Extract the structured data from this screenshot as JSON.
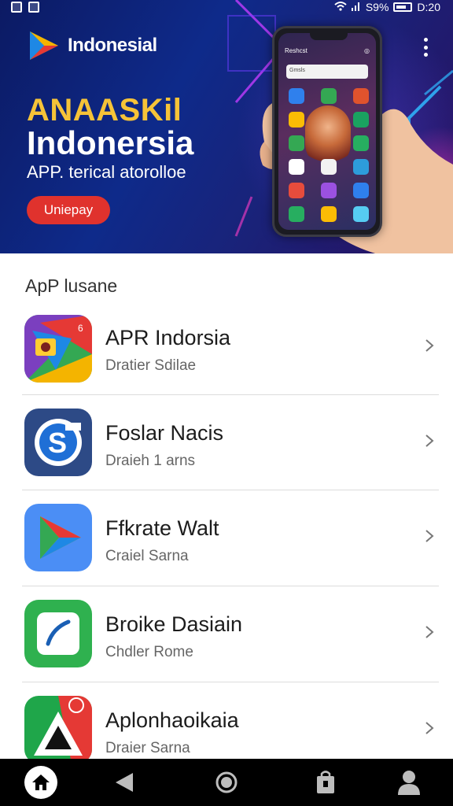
{
  "status_bar": {
    "right_text": "S9%",
    "time": "D:20"
  },
  "hero": {
    "brand_name": "Indonesial",
    "title_line1": "ANAASKil",
    "title_line2": "Indonersia",
    "subtitle": "APP. terical atorolloe",
    "cta_label": "Uniepay",
    "phone": {
      "top_label": "Reshcst",
      "search_placeholder": "Gmsls"
    }
  },
  "section": {
    "title": "ApP lusane"
  },
  "apps": [
    {
      "name": "APR Indorsia",
      "subtitle": "Dratier Sdilae",
      "icon": "app-icon-triangle-multicolor"
    },
    {
      "name": "Foslar Nacis",
      "subtitle": "Draieh 1 arns",
      "icon": "app-icon-s-blue"
    },
    {
      "name": "Ffkrate Walt",
      "subtitle": "Craiel Sarna",
      "icon": "app-icon-play"
    },
    {
      "name": "Broike Dasiain",
      "subtitle": "Chdler Rome",
      "icon": "app-icon-green-pen"
    },
    {
      "name": "Aplonhaoikaia",
      "subtitle": "Draier Sarna",
      "icon": "app-icon-triangle-green-red"
    }
  ],
  "bottom_nav": [
    "home-icon",
    "back-icon",
    "circle-home-icon",
    "bag-icon",
    "profile-icon"
  ],
  "colors": {
    "hero_bg": "#0e2a8a",
    "title_yellow": "#f6c338",
    "cta_red": "#e0322d",
    "nav_bg": "#000000"
  }
}
